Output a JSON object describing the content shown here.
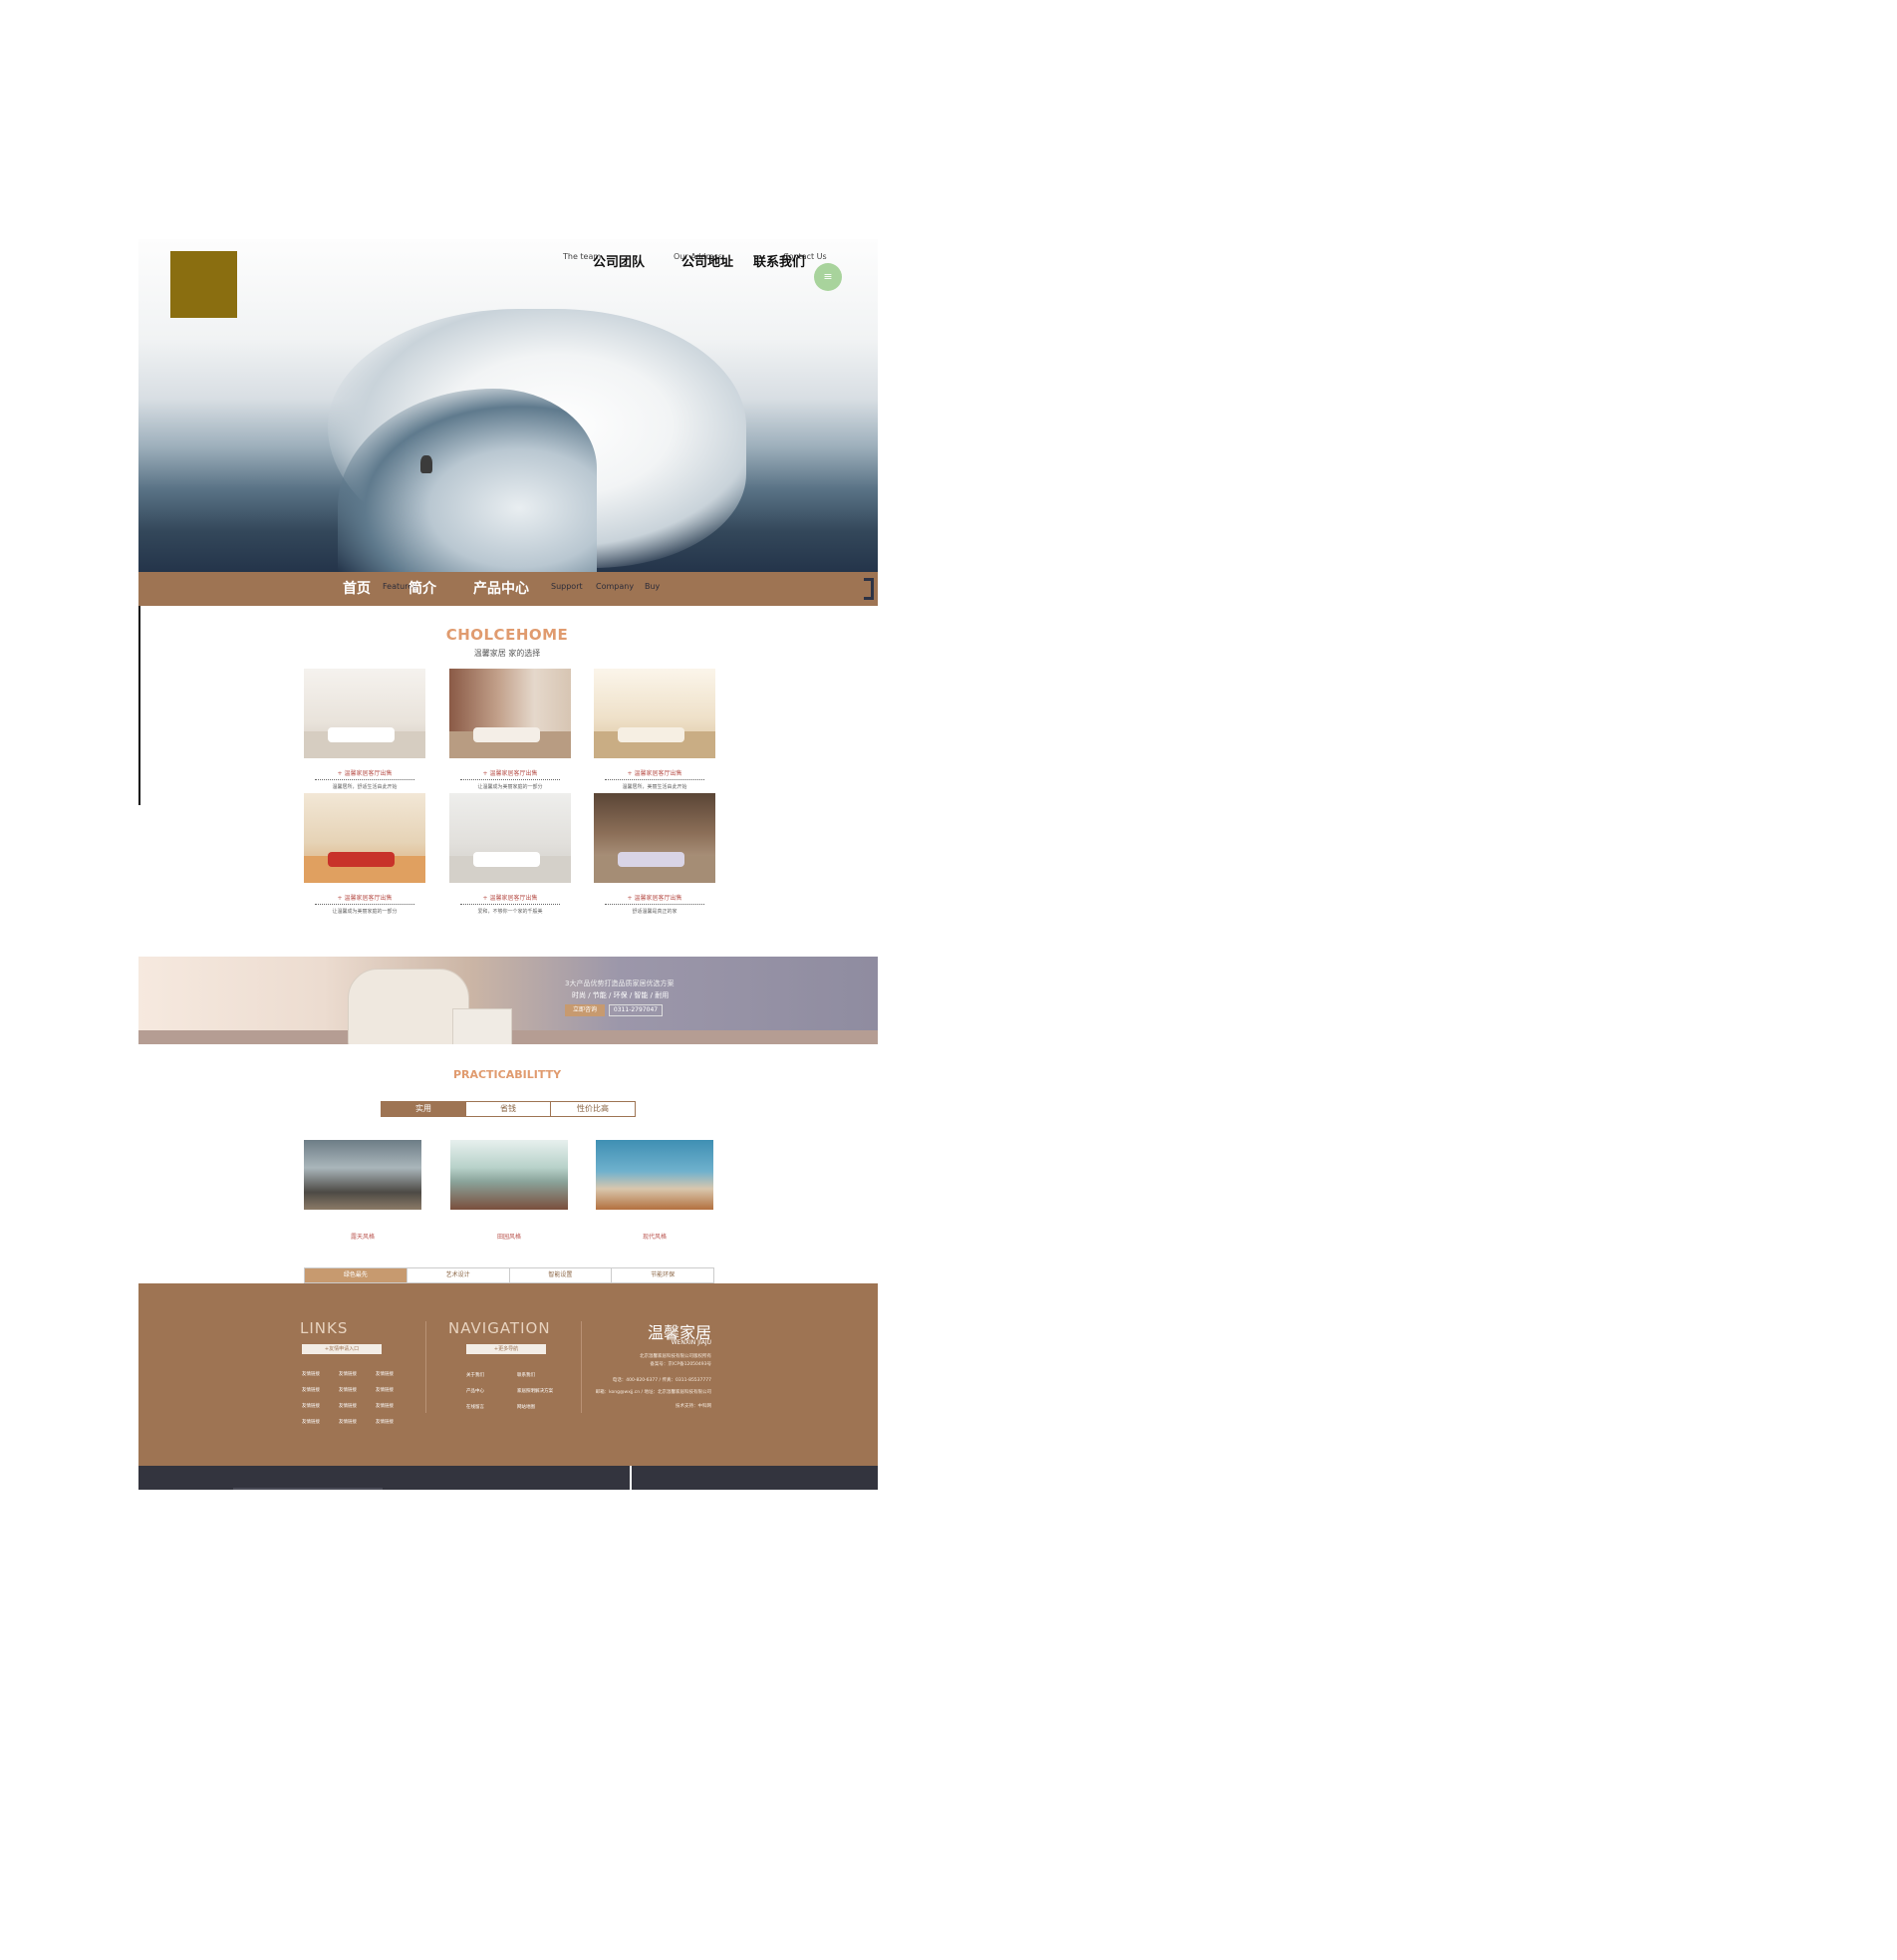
{
  "top_nav": [
    {
      "en": "The team",
      "zh": "公司团队"
    },
    {
      "en": "Our Address",
      "zh": "公司地址"
    },
    {
      "en": "Contact Us",
      "zh": "联系我们"
    }
  ],
  "menu_icon": "hamburger-icon",
  "main_nav": {
    "items": [
      {
        "zh": "首页",
        "en": ""
      },
      {
        "zh": "简介",
        "en": "Features"
      },
      {
        "zh": "产品中心",
        "en": ""
      }
    ],
    "small": [
      "Support",
      "Company",
      "Buy"
    ]
  },
  "choice": {
    "title": "CHOLCEHOME",
    "subtitle": "温馨家居  家的选择",
    "products": [
      {
        "caption": "+ 温馨家居客厅出售",
        "desc": "温馨居所，舒适生活由此开始"
      },
      {
        "caption": "+ 温馨家居客厅出售",
        "desc": "让温馨成为美丽家庭的一部分"
      },
      {
        "caption": "+ 温馨家居客厅出售",
        "desc": "温馨居所，美丽生活由此开始"
      },
      {
        "caption": "+ 温馨家居客厅出售",
        "desc": "让温馨成为美丽家庭的一部分"
      },
      {
        "caption": "+ 温馨家居客厅出售",
        "desc": "爱和，不够你一个家的千般美"
      },
      {
        "caption": "+ 温馨家居客厅出售",
        "desc": "舒适温馨是真正的家"
      }
    ]
  },
  "banner": {
    "line1": "3大产品优势打造品质家居优选方案",
    "line2": "时尚 / 节能 / 环保 / 智能 / 耐用",
    "cta": "立即咨询",
    "phone": "0311-2797047"
  },
  "practicability": {
    "title": "PRACTICABILITTY",
    "tabs": [
      "实用",
      "省钱",
      "性价比高"
    ],
    "styles": [
      "露天风格",
      "田园风格",
      "现代风格"
    ],
    "tabs2": [
      "绿色最先",
      "艺术设计",
      "智能设置",
      "节能环保"
    ]
  },
  "footer": {
    "links_title": "LINKS",
    "links_button": "+友情申请入口",
    "links": [
      "友情链接",
      "友情链接",
      "友情链接",
      "友情链接",
      "友情链接",
      "友情链接",
      "友情链接",
      "友情链接",
      "友情链接",
      "友情链接",
      "友情链接",
      "友情链接"
    ],
    "nav_title": "NAVIGATION",
    "nav_button": "+更多导航",
    "nav_links": [
      "关于我们",
      "联系我们",
      "产品中心",
      "家居照明解决方案",
      "在线留言",
      "网站地图"
    ],
    "brand_zh": "温馨家居",
    "brand_en": "WENXIN JIAJU",
    "info": [
      "北京温馨家居科技有限公司版权所有",
      "备案号：京ICP备12050493号",
      "电话：400-820-6377  /  传真：0311-85537777",
      "邮箱：kong@wxjj.cn  /  地址：北京温馨家居科技有限公司",
      "技术支持：中科网"
    ]
  },
  "colors": {
    "brand": "#9e7453",
    "accent": "#e09b6f",
    "logo": "#8a6e10",
    "menu_button": "#a8d39c",
    "bottom_bar": "#33343e"
  }
}
